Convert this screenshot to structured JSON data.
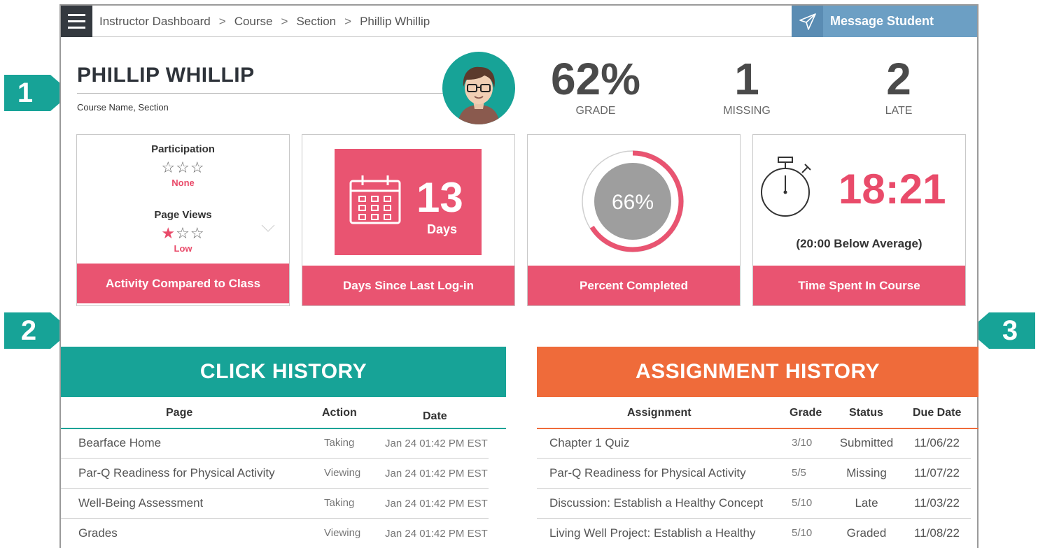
{
  "topbar": {
    "breadcrumb": [
      "Instructor Dashboard",
      "Course",
      "Section",
      "Phillip Whillip"
    ],
    "separator": ">",
    "message_button": "Message Student"
  },
  "student": {
    "name": "PHILLIP WHILLIP",
    "course": "Course Name, Section"
  },
  "stats": [
    {
      "value": "62%",
      "label": "GRADE"
    },
    {
      "value": "1",
      "label": "MISSING"
    },
    {
      "value": "2",
      "label": "LATE"
    }
  ],
  "activity": {
    "participation_label": "Participation",
    "participation_stars": 0,
    "participation_level": "None",
    "pageviews_label": "Page Views",
    "pageviews_stars": 1,
    "pageviews_level": "Low",
    "footer": "Activity Compared to Class"
  },
  "login": {
    "days": "13",
    "unit": "Days",
    "footer": "Days Since Last Log-in"
  },
  "completion": {
    "percent": 66,
    "label": "66%",
    "footer": "Percent Completed"
  },
  "time": {
    "value": "18:21",
    "sub": "(20:00 Below Average)",
    "footer": "Time Spent In Course"
  },
  "markers": [
    "1",
    "2",
    "3"
  ],
  "click_history": {
    "title": "CLICK HISTORY",
    "columns": [
      "Page",
      "Action",
      "Date"
    ],
    "rows": [
      {
        "page": "Bearface Home",
        "action": "Taking",
        "date": "Jan 24 01:42 PM EST"
      },
      {
        "page": "Par-Q Readiness for Physical Activity",
        "action": "Viewing",
        "date": "Jan 24 01:42 PM EST"
      },
      {
        "page": "Well-Being Assessment",
        "action": "Taking",
        "date": "Jan 24 01:42 PM EST"
      },
      {
        "page": "Grades",
        "action": "Viewing",
        "date": "Jan 24 01:42 PM EST"
      }
    ]
  },
  "assignment_history": {
    "title": "ASSIGNMENT HISTORY",
    "columns": [
      "Assignment",
      "Grade",
      "Status",
      "Due Date"
    ],
    "rows": [
      {
        "assignment": "Chapter 1 Quiz",
        "grade": "3/10",
        "status": "Submitted",
        "due": "11/06/22"
      },
      {
        "assignment": "Par-Q Readiness for Physical Activity",
        "grade": "5/5",
        "status": "Missing",
        "due": "11/07/22"
      },
      {
        "assignment": "Discussion: Establish a Healthy Concept",
        "grade": "5/10",
        "status": "Late",
        "due": "11/03/22"
      },
      {
        "assignment": "Living Well Project: Establish a Healthy",
        "grade": "5/10",
        "status": "Graded",
        "due": "11/08/22"
      }
    ]
  },
  "colors": {
    "accent_pink": "#e95471",
    "teal": "#17a397",
    "orange": "#ef6b3a",
    "message_blue": "#6c9fc4",
    "dark": "#34393f"
  },
  "icons": [
    "menu-icon",
    "paper-plane-icon",
    "calendar-icon",
    "stopwatch-icon",
    "star-icon"
  ]
}
